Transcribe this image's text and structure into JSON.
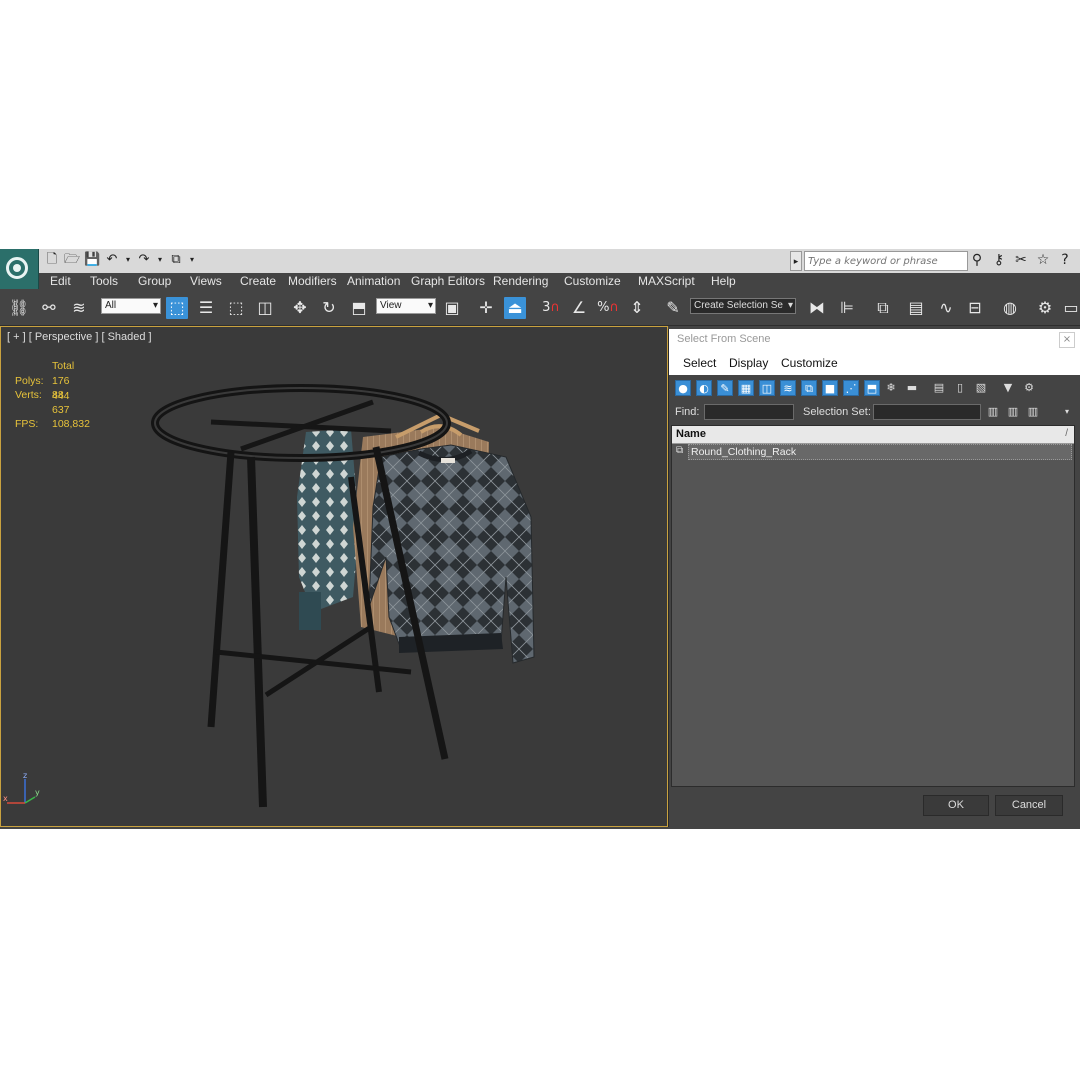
{
  "titlebar": {
    "search_placeholder": "Type a keyword or phrase"
  },
  "menu": [
    "Edit",
    "Tools",
    "Group",
    "Views",
    "Create",
    "Modifiers",
    "Animation",
    "Graph Editors",
    "Rendering",
    "Customize",
    "MAXScript",
    "Help"
  ],
  "toolbar": {
    "filter_value": "All",
    "ref_coord_value": "View",
    "snap_3": "3",
    "percent": "%",
    "selection_set_value": "Create Selection Se"
  },
  "viewport": {
    "label": "[ + ] [ Perspective ] [ Shaded ]",
    "stats": {
      "total": "Total",
      "polys_label": "Polys:",
      "polys": "176 444",
      "verts_label": "Verts:",
      "verts": "88 637",
      "fps_label": "FPS:",
      "fps": "108,832"
    },
    "axis": {
      "z": "z",
      "x": "x",
      "y": "y"
    }
  },
  "dialog": {
    "title": "Select From Scene",
    "close": "×",
    "menu": [
      "Select",
      "Display",
      "Customize"
    ],
    "find_label": "Find:",
    "selection_set_label": "Selection Set:",
    "column_name": "Name",
    "column_sort": "/",
    "items": [
      "Round_Clothing_Rack"
    ],
    "ok": "OK",
    "cancel": "Cancel"
  },
  "colors": {
    "accent": "#3a92d8",
    "viewport_border": "#c9a23f",
    "stats_text": "#e7c33a"
  }
}
